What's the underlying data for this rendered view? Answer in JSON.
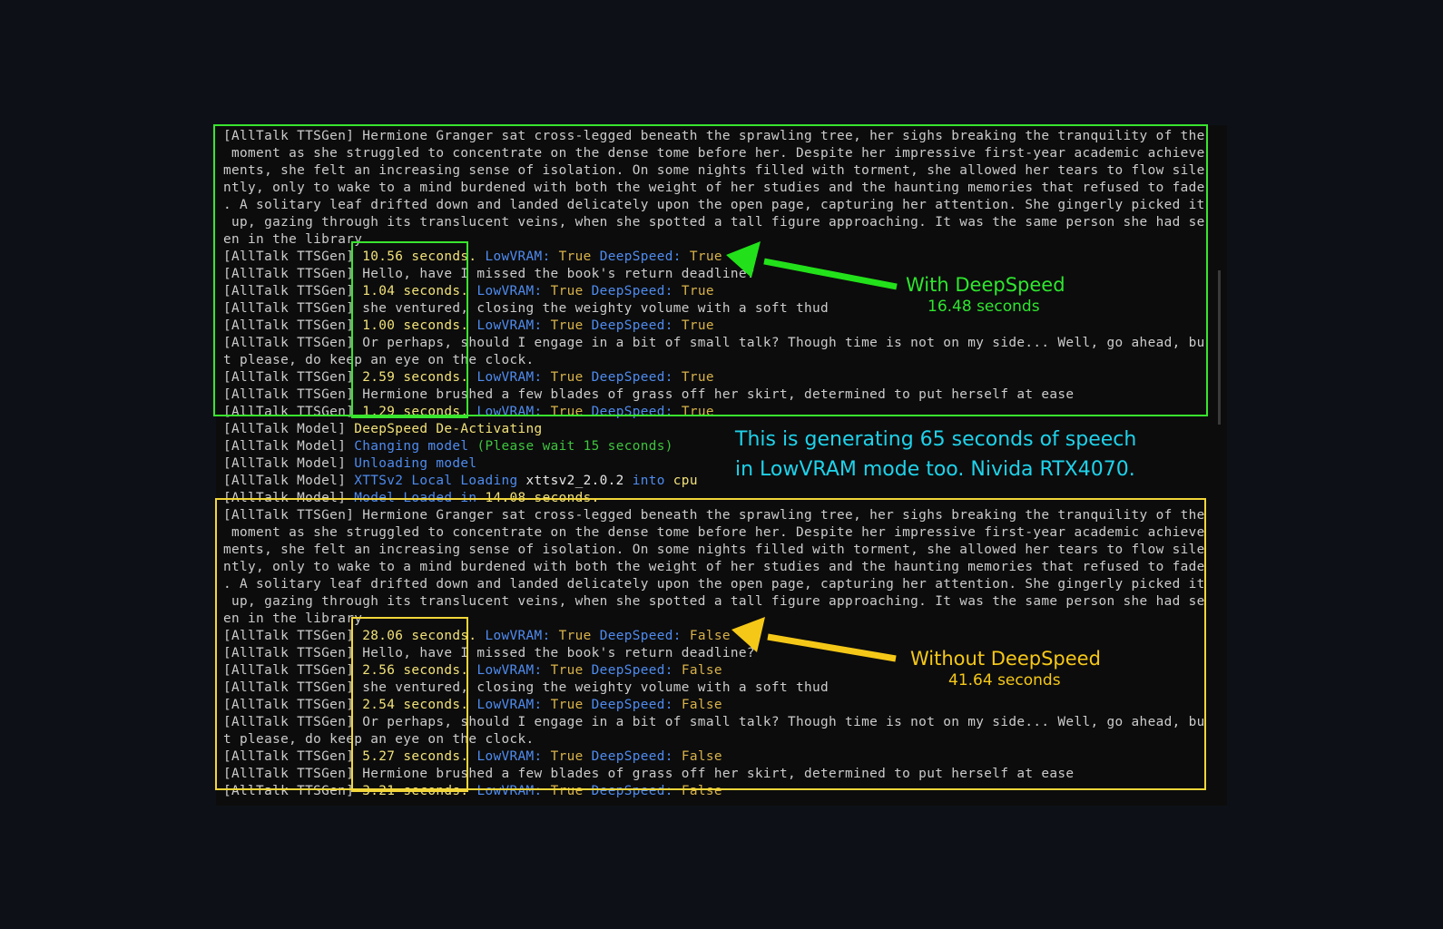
{
  "terminal": {
    "lines": [
      [
        {
          "t": "[AllTalk TTSGen] Hermione Granger sat cross-legged beneath the sprawling tree, her sighs breaking the tranquility of the"
        }
      ],
      [
        {
          "t": " moment as she struggled to concentrate on the dense tome before her. Despite her impressive first-year academic achieve"
        }
      ],
      [
        {
          "t": "ments, she felt an increasing sense of isolation. On some nights filled with torment, she allowed her tears to flow sile"
        }
      ],
      [
        {
          "t": "ntly, only to wake to a mind burdened with both the weight of her studies and the haunting memories that refused to fade"
        }
      ],
      [
        {
          "t": ". A solitary leaf drifted down and landed delicately upon the open page, capturing her attention. She gingerly picked it"
        }
      ],
      [
        {
          "t": " up, gazing through its translucent veins, when she spotted a tall figure approaching. It was the same person she had se"
        }
      ],
      [
        {
          "t": "en in the library"
        }
      ],
      [
        {
          "t": "[AllTalk TTSGen] "
        },
        {
          "t": "10.56 seconds.",
          "c": "c-yel"
        },
        {
          "t": " "
        },
        {
          "t": "LowVRAM:",
          "c": "c-blue"
        },
        {
          "t": " True ",
          "c": "c-gold"
        },
        {
          "t": "DeepSpeed:",
          "c": "c-blue"
        },
        {
          "t": " True",
          "c": "c-gold"
        }
      ],
      [
        {
          "t": "[AllTalk TTSGen] Hello, have I missed the book's return deadline?"
        }
      ],
      [
        {
          "t": "[AllTalk TTSGen] "
        },
        {
          "t": "1.04 seconds.",
          "c": "c-yel"
        },
        {
          "t": " "
        },
        {
          "t": "LowVRAM:",
          "c": "c-blue"
        },
        {
          "t": " True ",
          "c": "c-gold"
        },
        {
          "t": "DeepSpeed:",
          "c": "c-blue"
        },
        {
          "t": " True",
          "c": "c-gold"
        }
      ],
      [
        {
          "t": "[AllTalk TTSGen] she ventured, closing the weighty volume with a soft thud"
        }
      ],
      [
        {
          "t": "[AllTalk TTSGen] "
        },
        {
          "t": "1.00 seconds.",
          "c": "c-yel"
        },
        {
          "t": " "
        },
        {
          "t": "LowVRAM:",
          "c": "c-blue"
        },
        {
          "t": " True ",
          "c": "c-gold"
        },
        {
          "t": "DeepSpeed:",
          "c": "c-blue"
        },
        {
          "t": " True",
          "c": "c-gold"
        }
      ],
      [
        {
          "t": "[AllTalk TTSGen] Or perhaps, should I engage in a bit of small talk? Though time is not on my side... Well, go ahead, bu"
        }
      ],
      [
        {
          "t": "t please, do keep an eye on the clock."
        }
      ],
      [
        {
          "t": "[AllTalk TTSGen] "
        },
        {
          "t": "2.59 seconds.",
          "c": "c-yel"
        },
        {
          "t": " "
        },
        {
          "t": "LowVRAM:",
          "c": "c-blue"
        },
        {
          "t": " True ",
          "c": "c-gold"
        },
        {
          "t": "DeepSpeed:",
          "c": "c-blue"
        },
        {
          "t": " True",
          "c": "c-gold"
        }
      ],
      [
        {
          "t": "[AllTalk TTSGen] Hermione brushed a few blades of grass off her skirt, determined to put herself at ease"
        }
      ],
      [
        {
          "t": "[AllTalk TTSGen] "
        },
        {
          "t": "1.29 seconds.",
          "c": "c-yel"
        },
        {
          "t": " "
        },
        {
          "t": "LowVRAM:",
          "c": "c-blue"
        },
        {
          "t": " True ",
          "c": "c-gold"
        },
        {
          "t": "DeepSpeed:",
          "c": "c-blue"
        },
        {
          "t": " True",
          "c": "c-gold"
        }
      ],
      [
        {
          "t": "[AllTalk Model] "
        },
        {
          "t": "DeepSpeed De-Activating",
          "c": "c-yel"
        }
      ],
      [
        {
          "t": "[AllTalk Model] "
        },
        {
          "t": "Changing model",
          "c": "c-blue"
        },
        {
          "t": " "
        },
        {
          "t": "(Please wait 15 seconds)",
          "c": "c-green"
        }
      ],
      [
        {
          "t": "[AllTalk Model] "
        },
        {
          "t": "Unloading model",
          "c": "c-blue"
        }
      ],
      [
        {
          "t": "[AllTalk Model] "
        },
        {
          "t": "XTTSv2 Local Loading",
          "c": "c-blue"
        },
        {
          "t": " xttsv2_2.0.2 ",
          "c": "c-white"
        },
        {
          "t": "into",
          "c": "c-blue"
        },
        {
          "t": " cpu",
          "c": "c-yel"
        }
      ],
      [
        {
          "t": "[AllTalk Model] "
        },
        {
          "t": "Model Loaded in",
          "c": "c-blue"
        },
        {
          "t": " 14.08 seconds.",
          "c": "c-yel"
        }
      ],
      [
        {
          "t": "[AllTalk TTSGen] Hermione Granger sat cross-legged beneath the sprawling tree, her sighs breaking the tranquility of the"
        }
      ],
      [
        {
          "t": " moment as she struggled to concentrate on the dense tome before her. Despite her impressive first-year academic achieve"
        }
      ],
      [
        {
          "t": "ments, she felt an increasing sense of isolation. On some nights filled with torment, she allowed her tears to flow sile"
        }
      ],
      [
        {
          "t": "ntly, only to wake to a mind burdened with both the weight of her studies and the haunting memories that refused to fade"
        }
      ],
      [
        {
          "t": ". A solitary leaf drifted down and landed delicately upon the open page, capturing her attention. She gingerly picked it"
        }
      ],
      [
        {
          "t": " up, gazing through its translucent veins, when she spotted a tall figure approaching. It was the same person she had se"
        }
      ],
      [
        {
          "t": "en in the library"
        }
      ],
      [
        {
          "t": "[AllTalk TTSGen] "
        },
        {
          "t": "28.06 seconds.",
          "c": "c-yel"
        },
        {
          "t": " "
        },
        {
          "t": "LowVRAM:",
          "c": "c-blue"
        },
        {
          "t": " True ",
          "c": "c-gold"
        },
        {
          "t": "DeepSpeed:",
          "c": "c-blue"
        },
        {
          "t": " False",
          "c": "c-gold"
        }
      ],
      [
        {
          "t": "[AllTalk TTSGen] Hello, have I missed the book's return deadline?"
        }
      ],
      [
        {
          "t": "[AllTalk TTSGen] "
        },
        {
          "t": "2.56 seconds.",
          "c": "c-yel"
        },
        {
          "t": " "
        },
        {
          "t": "LowVRAM:",
          "c": "c-blue"
        },
        {
          "t": " True ",
          "c": "c-gold"
        },
        {
          "t": "DeepSpeed:",
          "c": "c-blue"
        },
        {
          "t": " False",
          "c": "c-gold"
        }
      ],
      [
        {
          "t": "[AllTalk TTSGen] she ventured, closing the weighty volume with a soft thud"
        }
      ],
      [
        {
          "t": "[AllTalk TTSGen] "
        },
        {
          "t": "2.54 seconds.",
          "c": "c-yel"
        },
        {
          "t": " "
        },
        {
          "t": "LowVRAM:",
          "c": "c-blue"
        },
        {
          "t": " True ",
          "c": "c-gold"
        },
        {
          "t": "DeepSpeed:",
          "c": "c-blue"
        },
        {
          "t": " False",
          "c": "c-gold"
        }
      ],
      [
        {
          "t": "[AllTalk TTSGen] Or perhaps, should I engage in a bit of small talk? Though time is not on my side... Well, go ahead, bu"
        }
      ],
      [
        {
          "t": "t please, do keep an eye on the clock."
        }
      ],
      [
        {
          "t": "[AllTalk TTSGen] "
        },
        {
          "t": "5.27 seconds.",
          "c": "c-yel"
        },
        {
          "t": " "
        },
        {
          "t": "LowVRAM:",
          "c": "c-blue"
        },
        {
          "t": " True ",
          "c": "c-gold"
        },
        {
          "t": "DeepSpeed:",
          "c": "c-blue"
        },
        {
          "t": " False",
          "c": "c-gold"
        }
      ],
      [
        {
          "t": "[AllTalk TTSGen] Hermione brushed a few blades of grass off her skirt, determined to put herself at ease"
        }
      ],
      [
        {
          "t": "[AllTalk TTSGen] "
        },
        {
          "t": "3.21 seconds.",
          "c": "c-yel"
        },
        {
          "t": " "
        },
        {
          "t": "LowVRAM:",
          "c": "c-blue"
        },
        {
          "t": " True ",
          "c": "c-gold"
        },
        {
          "t": "DeepSpeed:",
          "c": "c-blue"
        },
        {
          "t": " False",
          "c": "c-gold"
        }
      ]
    ]
  },
  "annotations": {
    "with_deepspeed": {
      "label": "With DeepSpeed",
      "total": "16.48 seconds"
    },
    "without_deepspeed": {
      "label": "Without DeepSpeed",
      "total": "41.64 seconds"
    },
    "info": {
      "line1": "This is generating 65 seconds of speech",
      "line2": "in LowVRAM mode too. Nivida RTX4070."
    }
  },
  "colors": {
    "green_highlight": "#39e52e",
    "yellow_highlight": "#f2d63a",
    "info_text": "#1fd2ea",
    "terminal_bg": "#0c0c0c"
  }
}
